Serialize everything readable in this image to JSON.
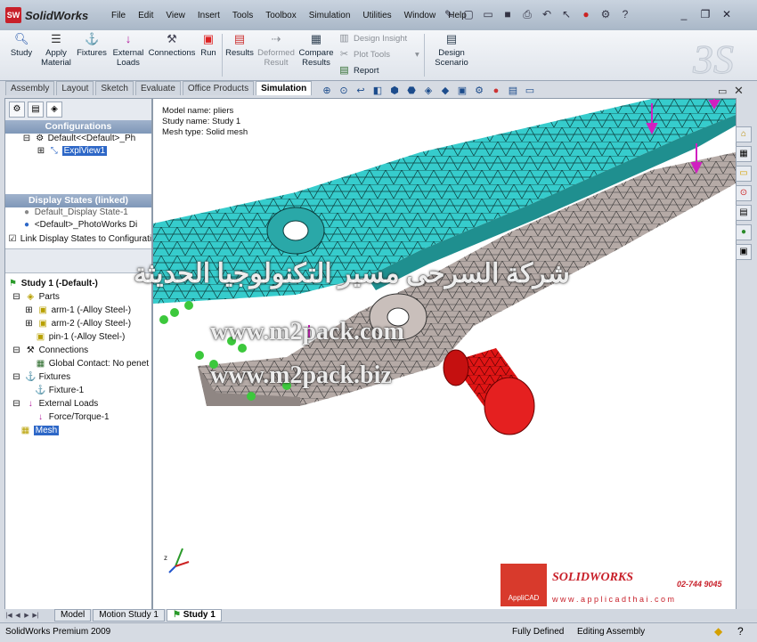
{
  "app": {
    "logo_text": "SolidWorks",
    "logo_mark": "SW"
  },
  "menu": [
    "File",
    "Edit",
    "View",
    "Insert",
    "Tools",
    "Toolbox",
    "Simulation",
    "Utilities",
    "Window",
    "Help"
  ],
  "command_manager": {
    "study": "Study",
    "apply_material": [
      "Apply",
      "Material"
    ],
    "fixtures": "Fixtures",
    "external_loads": [
      "External",
      "Loads"
    ],
    "connections": "Connections",
    "run": "Run",
    "results": "Results",
    "deformed_result": [
      "Deformed",
      "Result"
    ],
    "compare_results": [
      "Compare",
      "Results"
    ],
    "design_insight": "Design Insight",
    "plot_tools": "Plot Tools",
    "report": "Report",
    "design_scenario": [
      "Design",
      "Scenario"
    ]
  },
  "tabs": [
    "Assembly",
    "Layout",
    "Sketch",
    "Evaluate",
    "Office Products",
    "Simulation"
  ],
  "active_tab": "Simulation",
  "left_panel": {
    "configurations_header": "Configurations",
    "config_item": "Default<<Default>_Ph",
    "expl_view": "ExplView1",
    "display_states_header": "Display States (linked)",
    "display_state_1": "Default_Display State-1",
    "display_state_2": "<Default>_PhotoWorks Di",
    "link_checkbox_label": "Link Display States to Configuratio",
    "study_tree": {
      "root": "Study 1 (-Default-)",
      "parts": "Parts",
      "part_1": "arm-1 (-Alloy Steel-)",
      "part_2": "arm-2 (-Alloy Steel-)",
      "part_3": "pin-1 (-Alloy Steel-)",
      "connections": "Connections",
      "global_contact": "Global Contact: No penet",
      "fixtures": "Fixtures",
      "fixture_1": "Fixture-1",
      "external_loads": "External Loads",
      "force_1": "Force/Torque-1",
      "mesh": "Mesh"
    }
  },
  "viewport_info": {
    "model_name": "Model name: pliers",
    "study_name": "Study name: Study 1",
    "mesh_type": "Mesh type: Solid mesh"
  },
  "watermarks": {
    "arabic": "شركة السرحى مسير التكنولوجيا الحديثة",
    "url_1": "www.m2pack.com",
    "url_2": "www.m2pack.biz"
  },
  "branding": {
    "applicad": "AppliCAD",
    "solidworks": "SOLIDWORKS",
    "phone": "02-744 9045",
    "website": "w w w . a p p l i c a d t h a i . c o m"
  },
  "bottom_tabs": [
    "Model",
    "Motion Study 1",
    "Study 1"
  ],
  "active_bottom_tab": "Study 1",
  "status": {
    "left": "SolidWorks Premium 2009",
    "fully_defined": "Fully Defined",
    "editing": "Editing Assembly"
  },
  "colors": {
    "arm_cyan": "#33cccc",
    "arm_gray": "#b5aaa6",
    "pin_red": "#e01515",
    "fixture_green": "#3cc83c",
    "load_magenta": "#d020c0"
  }
}
